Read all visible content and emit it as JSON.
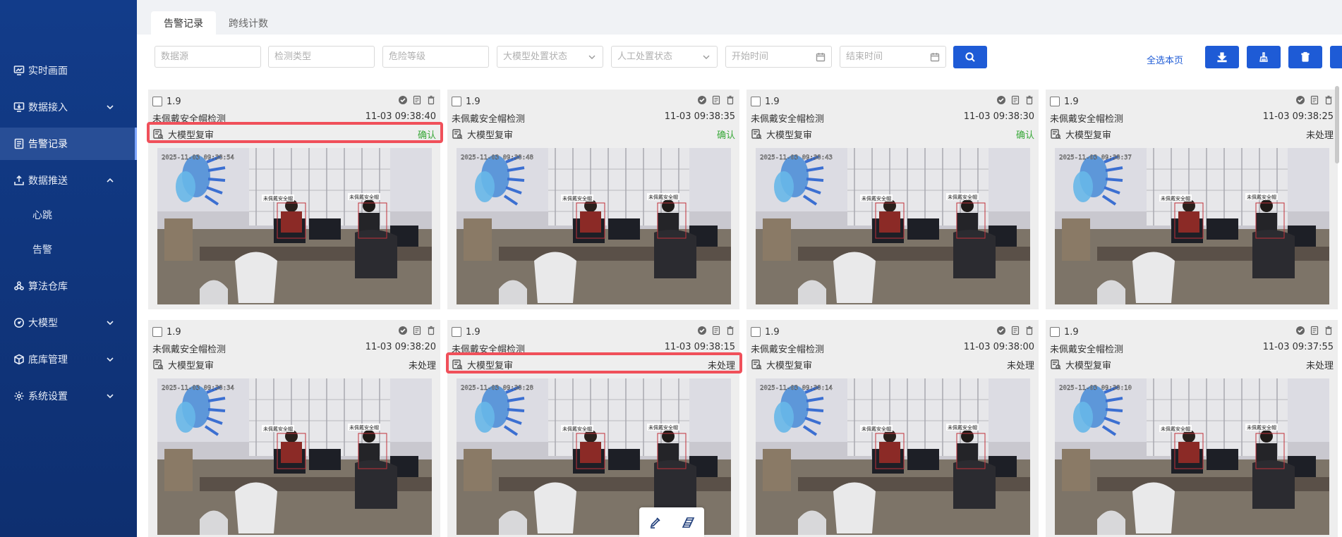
{
  "sidebar": {
    "items": [
      {
        "label": "实时画面",
        "icon": "monitor-chart-icon"
      },
      {
        "label": "数据接入",
        "icon": "screen-download-icon",
        "chevron": "down"
      },
      {
        "label": "告警记录",
        "icon": "document-list-icon",
        "active": true
      },
      {
        "label": "数据推送",
        "icon": "upload-tray-icon",
        "chevron": "up"
      },
      {
        "label": "算法仓库",
        "icon": "nodes-icon"
      },
      {
        "label": "大模型",
        "icon": "gauge-icon",
        "chevron": "down"
      },
      {
        "label": "底库管理",
        "icon": "cube-icon",
        "chevron": "down"
      },
      {
        "label": "系统设置",
        "icon": "gear-icon",
        "chevron": "down"
      }
    ],
    "sub_items": [
      {
        "label": "心跳"
      },
      {
        "label": "告警"
      }
    ]
  },
  "tabs": [
    {
      "label": "告警记录",
      "active": true
    },
    {
      "label": "跨线计数",
      "active": false
    }
  ],
  "toolbar": {
    "data_source_placeholder": "数据源",
    "detect_type_placeholder": "检测类型",
    "risk_level_placeholder": "危险等级",
    "llm_status_placeholder": "大模型处置状态",
    "manual_status_placeholder": "人工处置状态",
    "start_time_placeholder": "开始时间",
    "end_time_placeholder": "结束时间",
    "select_all_label": "全选本页"
  },
  "colors": {
    "sidebar_bg": "#123c8a",
    "primary": "#1e5bd6",
    "confirm_green": "#3aa93a",
    "highlight_red": "#f0505a"
  },
  "cards": [
    {
      "score": "1.9",
      "type": "未佩戴安全帽检测",
      "time": "11-03 09:38:40",
      "review": "大模型复审",
      "status": "确认",
      "status_kind": "ok",
      "stamp": "2025-11-03 09:38:54",
      "highlight": true
    },
    {
      "score": "1.9",
      "type": "未佩戴安全帽检测",
      "time": "11-03 09:38:35",
      "review": "大模型复审",
      "status": "确认",
      "status_kind": "ok",
      "stamp": "2025-11-03 09:38:48",
      "highlight": false
    },
    {
      "score": "1.9",
      "type": "未佩戴安全帽检测",
      "time": "11-03 09:38:30",
      "review": "大模型复审",
      "status": "确认",
      "status_kind": "ok",
      "stamp": "2025-11-03 09:38:43",
      "highlight": false
    },
    {
      "score": "1.9",
      "type": "未佩戴安全帽检测",
      "time": "11-03 09:38:25",
      "review": "大模型复审",
      "status": "未处理",
      "status_kind": "pending",
      "stamp": "2025-11-03 09:38:37",
      "highlight": false
    },
    {
      "score": "1.9",
      "type": "未佩戴安全帽检测",
      "time": "11-03 09:38:20",
      "review": "大模型复审",
      "status": "未处理",
      "status_kind": "pending",
      "stamp": "2025-11-03 09:38:34",
      "highlight": false
    },
    {
      "score": "1.9",
      "type": "未佩戴安全帽检测",
      "time": "11-03 09:38:15",
      "review": "大模型复审",
      "status": "未处理",
      "status_kind": "pending",
      "stamp": "2025-11-03 09:38:28",
      "highlight": true
    },
    {
      "score": "1.9",
      "type": "未佩戴安全帽检测",
      "time": "11-03 09:38:00",
      "review": "大模型复审",
      "status": "未处理",
      "status_kind": "pending",
      "stamp": "2025-11-03 09:38:14",
      "highlight": false
    },
    {
      "score": "1.9",
      "type": "未佩戴安全帽检测",
      "time": "11-03 09:37:55",
      "review": "大模型复审",
      "status": "未处理",
      "status_kind": "pending",
      "stamp": "2025-11-03 09:38:10",
      "highlight": false
    }
  ],
  "overlay_label": "未佩戴安全帽"
}
